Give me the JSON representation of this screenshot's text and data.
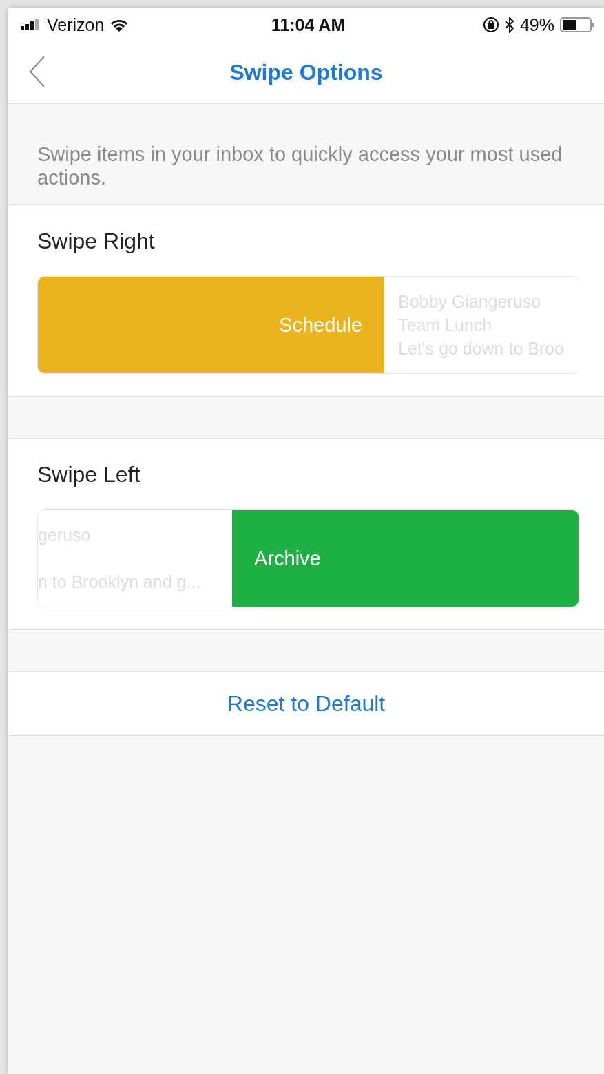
{
  "status_bar": {
    "carrier": "Verizon",
    "time": "11:04 AM",
    "battery": "49%"
  },
  "nav": {
    "title": "Swipe Options"
  },
  "description": "Swipe items in your inbox to quickly access your most used actions.",
  "sections": [
    {
      "title": "Swipe Right",
      "kind": "right",
      "action": {
        "label": "Schedule",
        "color": "#e9b41e"
      },
      "preview": [
        "Bobby Giangeruso",
        "Team Lunch",
        "Let's go down to Broo"
      ]
    },
    {
      "title": "Swipe Left",
      "kind": "left",
      "action": {
        "label": "Archive",
        "color": "#1eb045"
      },
      "preview": [
        "geruso",
        "n to Brooklyn and g..."
      ]
    }
  ],
  "reset": {
    "label": "Reset to Default"
  }
}
